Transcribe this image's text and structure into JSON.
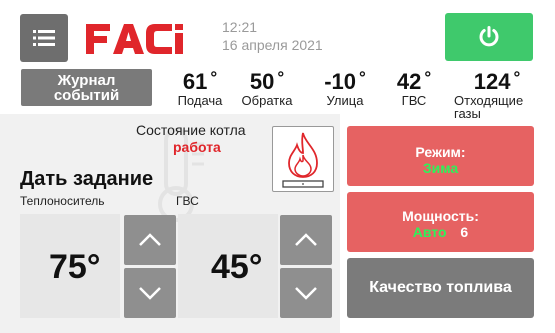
{
  "header": {
    "time": "12:21",
    "date": "16 апреля 2021",
    "logo_text": "FACI"
  },
  "journal": {
    "label": "Журнал событий"
  },
  "readings": [
    {
      "value": "61",
      "unit": "°",
      "label": "Подача"
    },
    {
      "value": "50",
      "unit": "°",
      "label": "Обратка"
    },
    {
      "value": "-10",
      "unit": "°",
      "label": "Улица"
    },
    {
      "value": "42",
      "unit": "°",
      "label": "ГВС"
    },
    {
      "value": "124",
      "unit": "°",
      "label": "Отходящие газы"
    }
  ],
  "status": {
    "label": "Состояние котла",
    "value": "работа"
  },
  "setpoint": {
    "title": "Дать задание",
    "coolant_label": "Теплоноситель",
    "dhw_label": "ГВС",
    "coolant_value": "75°",
    "dhw_value": "45°"
  },
  "mode": {
    "label": "Режим:",
    "value": "Зима"
  },
  "power": {
    "label": "Мощность:",
    "mode": "Авто",
    "level": "6"
  },
  "fuel": {
    "label": "Качество топлива"
  },
  "colors": {
    "brand_red": "#e0262b",
    "power_green": "#3fc96c",
    "button_red": "#e66262",
    "button_gray": "#7b7b7b",
    "accent_green_text": "#2ef15a"
  },
  "icons": {
    "menu": "menu-icon",
    "power": "power-icon",
    "flame": "flame-icon",
    "up": "chevron-up-icon",
    "down": "chevron-down-icon"
  }
}
